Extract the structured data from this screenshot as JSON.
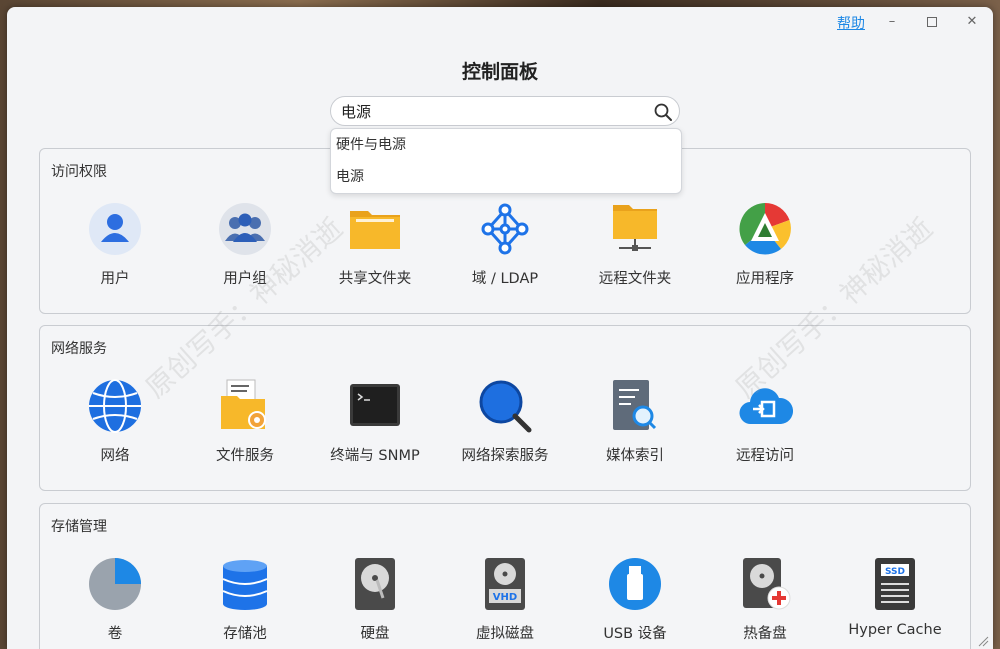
{
  "header": {
    "help_label": "帮助",
    "minimize": "–",
    "close": "✕",
    "title": "控制面板"
  },
  "search": {
    "value": "电源",
    "suggestions": [
      "硬件与电源",
      "电源"
    ]
  },
  "sections": [
    {
      "title": "访问权限",
      "items": [
        {
          "label": "用户",
          "icon": "user-icon"
        },
        {
          "label": "用户组",
          "icon": "user-group-icon"
        },
        {
          "label": "共享文件夹",
          "icon": "shared-folder-icon"
        },
        {
          "label": "域 / LDAP",
          "icon": "domain-ldap-icon"
        },
        {
          "label": "远程文件夹",
          "icon": "remote-folder-icon"
        },
        {
          "label": "应用程序",
          "icon": "applications-icon"
        }
      ]
    },
    {
      "title": "网络服务",
      "items": [
        {
          "label": "网络",
          "icon": "network-globe-icon"
        },
        {
          "label": "文件服务",
          "icon": "file-services-icon"
        },
        {
          "label": "终端与 SNMP",
          "icon": "terminal-icon"
        },
        {
          "label": "网络探索服务",
          "icon": "network-discovery-icon"
        },
        {
          "label": "媒体索引",
          "icon": "media-index-icon"
        },
        {
          "label": "远程访问",
          "icon": "remote-access-cloud-icon"
        }
      ]
    },
    {
      "title": "存储管理",
      "items": [
        {
          "label": "卷",
          "icon": "volume-pie-icon"
        },
        {
          "label": "存储池",
          "icon": "storage-pool-icon"
        },
        {
          "label": "硬盘",
          "icon": "hard-disk-icon"
        },
        {
          "label": "虚拟磁盘",
          "icon": "virtual-disk-icon"
        },
        {
          "label": "USB 设备",
          "icon": "usb-device-icon"
        },
        {
          "label": "热备盘",
          "icon": "hot-spare-icon"
        },
        {
          "label": "Hyper Cache",
          "icon": "ssd-cache-icon"
        }
      ]
    }
  ],
  "icon_text": {
    "vhd": "VHD",
    "ssd": "SSD"
  },
  "watermark_text": "原创写手：神秘消逝",
  "colors": {
    "accent": "#1e88e5",
    "folder": "#f7b82a",
    "background": "#f3f4f6"
  }
}
